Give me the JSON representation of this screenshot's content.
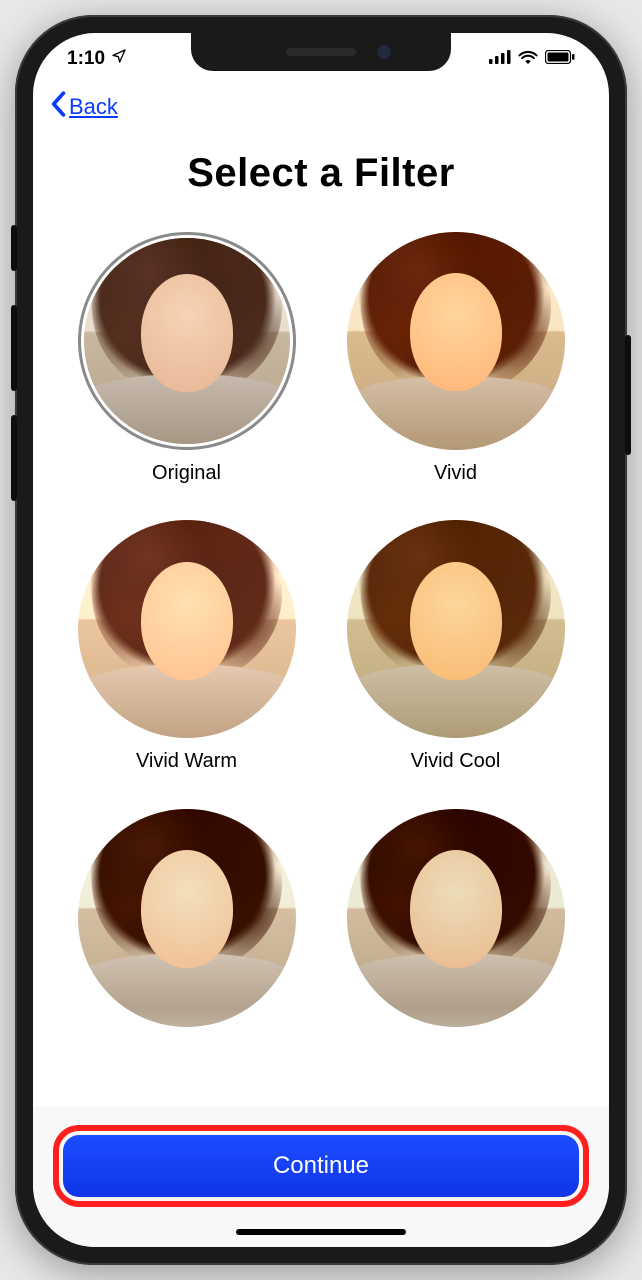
{
  "status": {
    "time": "1:10",
    "location_icon": "location-arrow"
  },
  "nav": {
    "back_label": "Back"
  },
  "title": "Select a Filter",
  "filters": [
    {
      "label": "Original",
      "selected": true
    },
    {
      "label": "Vivid",
      "selected": false
    },
    {
      "label": "Vivid Warm",
      "selected": false
    },
    {
      "label": "Vivid Cool",
      "selected": false
    }
  ],
  "continue_label": "Continue"
}
